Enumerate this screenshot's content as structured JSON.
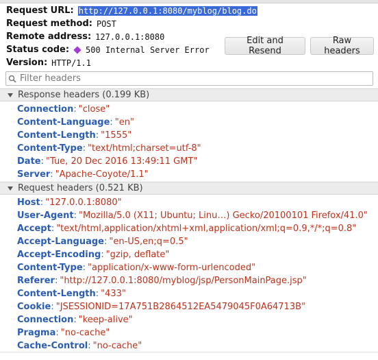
{
  "summary": {
    "url_label": "Request URL:",
    "url_value": "http://127.0.0.1:8080/myblog/blog.do",
    "method_label": "Request method:",
    "method_value": "POST",
    "remote_label": "Remote address:",
    "remote_value": "127.0.0.1:8080",
    "status_label": "Status code:",
    "status_value": "500 Internal Server Error",
    "status_color": "#a23bd8",
    "version_label": "Version:",
    "version_value": "HTTP/1.1"
  },
  "buttons": {
    "edit_resend": "Edit and Resend",
    "raw_headers": "Raw headers"
  },
  "filter": {
    "placeholder": "Filter headers"
  },
  "response": {
    "title": "Response headers (0.199 KB)",
    "headers": [
      {
        "name": "Connection",
        "value": "\"close\""
      },
      {
        "name": "Content-Language",
        "value": "\"en\""
      },
      {
        "name": "Content-Length",
        "value": "\"1555\""
      },
      {
        "name": "Content-Type",
        "value": "\"text/html;charset=utf-8\""
      },
      {
        "name": "Date",
        "value": "\"Tue, 20 Dec 2016 13:49:11 GMT\""
      },
      {
        "name": "Server",
        "value": "\"Apache-Coyote/1.1\""
      }
    ]
  },
  "request": {
    "title": "Request headers (0.521 KB)",
    "headers": [
      {
        "name": "Host",
        "value": "\"127.0.0.1:8080\""
      },
      {
        "name": "User-Agent",
        "value": "\"Mozilla/5.0 (X11; Ubuntu; Linu…) Gecko/20100101 Firefox/41.0\""
      },
      {
        "name": "Accept",
        "value": "\"text/html,application/xhtml+xml,application/xml;q=0.9,*/*;q=0.8\""
      },
      {
        "name": "Accept-Language",
        "value": "\"en-US,en;q=0.5\""
      },
      {
        "name": "Accept-Encoding",
        "value": "\"gzip, deflate\""
      },
      {
        "name": "Content-Type",
        "value": "\"application/x-www-form-urlencoded\""
      },
      {
        "name": "Referer",
        "value": "\"http://127.0.0.1:8080/myblog/jsp/PersonMainPage.jsp\""
      },
      {
        "name": "Content-Length",
        "value": "\"433\""
      },
      {
        "name": "Cookie",
        "value": "\"JSESSIONID=17A751B2864512EA5479045F0A64713B\""
      },
      {
        "name": "Connection",
        "value": "\"keep-alive\""
      },
      {
        "name": "Pragma",
        "value": "\"no-cache\""
      },
      {
        "name": "Cache-Control",
        "value": "\"no-cache\""
      }
    ]
  }
}
